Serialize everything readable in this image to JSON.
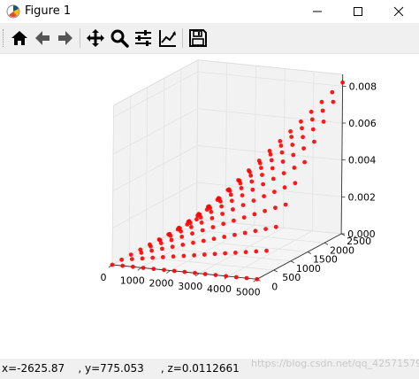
{
  "window": {
    "title": "Figure 1",
    "icons": [
      "matplotlib-icon",
      "minimize-icon",
      "maximize-icon",
      "close-icon"
    ]
  },
  "toolbar": {
    "buttons": [
      {
        "name": "home",
        "icon": "home-icon"
      },
      {
        "name": "back",
        "icon": "arrow-left-icon"
      },
      {
        "name": "forward",
        "icon": "arrow-right-icon"
      },
      {
        "name": "pan",
        "icon": "move-icon"
      },
      {
        "name": "zoom",
        "icon": "magnifier-icon"
      },
      {
        "name": "subplots",
        "icon": "sliders-icon"
      },
      {
        "name": "customize",
        "icon": "line-chart-icon"
      },
      {
        "name": "save",
        "icon": "floppy-icon"
      }
    ]
  },
  "chart_data": {
    "type": "scatter",
    "projection": "3d",
    "marker_color": "#ff0000",
    "x_range": [
      0,
      5000
    ],
    "y_range": [
      0,
      2500
    ],
    "z_range": [
      0,
      0.008
    ],
    "x_ticks": [
      "0",
      "1000",
      "2000",
      "3000",
      "4000",
      "5000"
    ],
    "y_ticks": [
      "0",
      "500",
      "1000",
      "1500",
      "2000",
      "2500"
    ],
    "z_ticks": [
      "0.000",
      "0.002",
      "0.004",
      "0.006",
      "0.008"
    ],
    "surface": "z rises from 0 at (x=0, y=0) to about 0.008 at (x=5000, y=2500) across a regular grid of points"
  },
  "status": {
    "coords": "x=-2625.87    , y=775.053     , z=0.0112661",
    "watermark": "https://blog.csdn.net/qq_42571579"
  }
}
